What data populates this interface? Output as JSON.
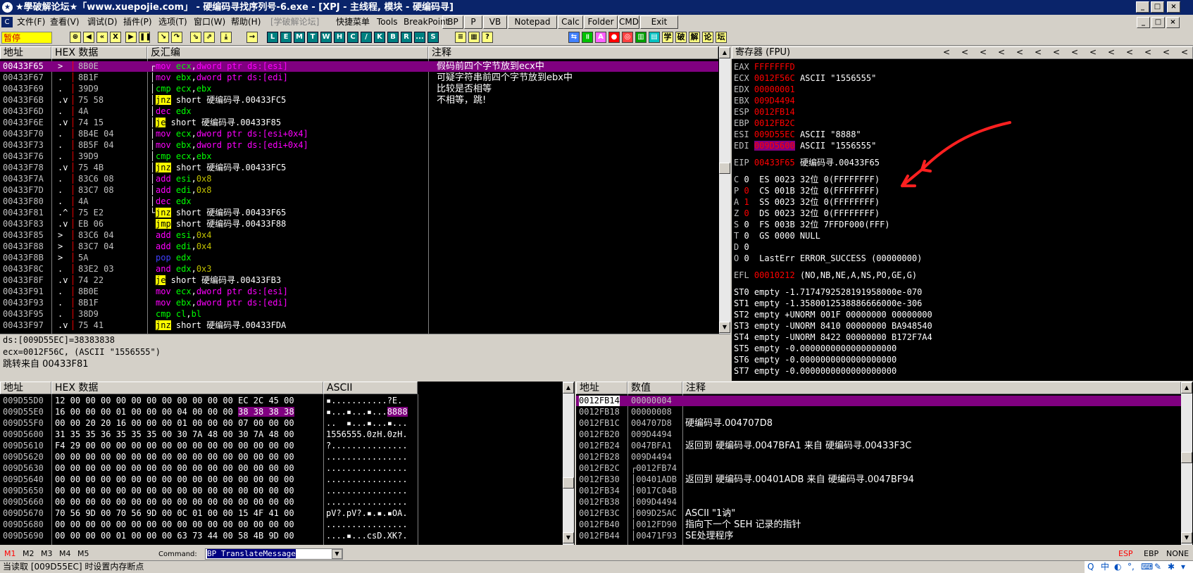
{
  "title": "★學破解论坛★「www.xuepojie.com」 - 硬编码寻找序列号-6.exe - [XPJ - 主线程, 模块 - 硬编码寻]",
  "window_buttons": [
    "_",
    "□",
    "×"
  ],
  "menu": {
    "items": [
      "文件(F)",
      "查看(V)",
      "调试(D)",
      "插件(P)",
      "选项(T)",
      "窗口(W)",
      "帮助(H)",
      "[学破解论坛]",
      "快捷菜单",
      "Tools",
      "BreakPoint"
    ],
    "buttons": [
      "BP",
      "P",
      "VB",
      "Notepad",
      "Calc",
      "Folder",
      "CMD",
      "Exit"
    ],
    "child_buttons": [
      "_",
      "□",
      "×"
    ]
  },
  "toolbar": {
    "status": "暂停",
    "letters": [
      "L",
      "E",
      "M",
      "T",
      "W",
      "H",
      "C",
      "/",
      "K",
      "B",
      "R",
      "...",
      "S"
    ],
    "cjk": [
      "学",
      "破",
      "解",
      "论",
      "坛"
    ]
  },
  "disasm": {
    "headers": {
      "addr": "地址",
      "hex": "HEX 数据",
      "asm": "反汇编",
      "comment": "注释"
    },
    "rows": [
      {
        "addr": "00433F65",
        "mark": ">",
        "hex": "8B0E",
        "asm": [
          [
            "c-mov",
            "mov "
          ],
          [
            "c-reg",
            "ecx"
          ],
          [
            "c-white",
            ","
          ],
          [
            "c-mov",
            "dword ptr ds:[esi]"
          ]
        ],
        "comment": "假码前四个字节放到ecx中",
        "sel": true,
        "bracket": "┌"
      },
      {
        "addr": "00433F67",
        "mark": ".",
        "hex": "8B1F",
        "asm": [
          [
            "c-mov",
            "mov "
          ],
          [
            "c-reg",
            "ebx"
          ],
          [
            "c-white",
            ","
          ],
          [
            "c-mov",
            "dword ptr ds:[edi]"
          ]
        ],
        "comment": "可疑字符串前四个字节放到ebx中",
        "bracket": "│"
      },
      {
        "addr": "00433F69",
        "mark": ".",
        "hex": "39D9",
        "asm": [
          [
            "c-cmp",
            "cmp "
          ],
          [
            "c-reg",
            "ecx"
          ],
          [
            "c-white",
            ","
          ],
          [
            "c-reg",
            "ebx"
          ]
        ],
        "comment": "比较是否相等",
        "bracket": "│"
      },
      {
        "addr": "00433F6B",
        "mark": ".v",
        "hex": "75 58",
        "asm": [
          [
            "kw-red",
            "jnz"
          ],
          [
            "c-white",
            " short 硬编码寻.00433FC5"
          ]
        ],
        "comment": "不相等，跳!",
        "bracket": "│"
      },
      {
        "addr": "00433F6D",
        "mark": ".",
        "hex": "4A",
        "asm": [
          [
            "c-addsub",
            "dec "
          ],
          [
            "c-reg",
            "edx"
          ]
        ],
        "comment": "",
        "bracket": "│"
      },
      {
        "addr": "00433F6E",
        "mark": ".v",
        "hex": "74 15",
        "asm": [
          [
            "kw-red",
            "je"
          ],
          [
            "c-white",
            " short 硬编码寻.00433F85"
          ]
        ],
        "comment": "",
        "bracket": "│"
      },
      {
        "addr": "00433F70",
        "mark": ".",
        "hex": "8B4E 04",
        "asm": [
          [
            "c-mov",
            "mov "
          ],
          [
            "c-reg",
            "ecx"
          ],
          [
            "c-white",
            ","
          ],
          [
            "c-mov",
            "dword ptr ds:[esi+0x4]"
          ]
        ],
        "comment": "",
        "bracket": "│"
      },
      {
        "addr": "00433F73",
        "mark": ".",
        "hex": "8B5F 04",
        "asm": [
          [
            "c-mov",
            "mov "
          ],
          [
            "c-reg",
            "ebx"
          ],
          [
            "c-white",
            ","
          ],
          [
            "c-mov",
            "dword ptr ds:[edi+0x4]"
          ]
        ],
        "comment": "",
        "bracket": "│"
      },
      {
        "addr": "00433F76",
        "mark": ".",
        "hex": "39D9",
        "asm": [
          [
            "c-cmp",
            "cmp "
          ],
          [
            "c-reg",
            "ecx"
          ],
          [
            "c-white",
            ","
          ],
          [
            "c-reg",
            "ebx"
          ]
        ],
        "comment": "",
        "bracket": "│"
      },
      {
        "addr": "00433F78",
        "mark": ".v",
        "hex": "75 4B",
        "asm": [
          [
            "kw-red",
            "jnz"
          ],
          [
            "c-white",
            " short 硬编码寻.00433FC5"
          ]
        ],
        "comment": "",
        "bracket": "│"
      },
      {
        "addr": "00433F7A",
        "mark": ".",
        "hex": "83C6 08",
        "asm": [
          [
            "c-addsub",
            "add "
          ],
          [
            "c-reg",
            "esi"
          ],
          [
            "c-white",
            ","
          ],
          [
            "c-num",
            "0x8"
          ]
        ],
        "comment": "",
        "bracket": "│"
      },
      {
        "addr": "00433F7D",
        "mark": ".",
        "hex": "83C7 08",
        "asm": [
          [
            "c-addsub",
            "add "
          ],
          [
            "c-reg",
            "edi"
          ],
          [
            "c-white",
            ","
          ],
          [
            "c-num",
            "0x8"
          ]
        ],
        "comment": "",
        "bracket": "│"
      },
      {
        "addr": "00433F80",
        "mark": ".",
        "hex": "4A",
        "asm": [
          [
            "c-addsub",
            "dec "
          ],
          [
            "c-reg",
            "edx"
          ]
        ],
        "comment": "",
        "bracket": "│"
      },
      {
        "addr": "00433F81",
        "mark": ".^",
        "hex": "75 E2",
        "asm": [
          [
            "kw-red",
            "jnz"
          ],
          [
            "c-white",
            " short 硬编码寻.00433F65"
          ]
        ],
        "comment": "",
        "bracket": "└"
      },
      {
        "addr": "00433F83",
        "mark": ".v",
        "hex": "EB 06",
        "asm": [
          [
            "kw-red",
            "jmp"
          ],
          [
            "c-white",
            " short 硬编码寻.00433F88"
          ]
        ],
        "comment": "",
        "bracket": " "
      },
      {
        "addr": "00433F85",
        "mark": ">",
        "hex": "83C6 04",
        "asm": [
          [
            "c-addsub",
            "add "
          ],
          [
            "c-reg",
            "esi"
          ],
          [
            "c-white",
            ","
          ],
          [
            "c-num",
            "0x4"
          ]
        ],
        "comment": "",
        "bracket": " "
      },
      {
        "addr": "00433F88",
        "mark": ">",
        "hex": "83C7 04",
        "asm": [
          [
            "c-addsub",
            "add "
          ],
          [
            "c-reg",
            "edi"
          ],
          [
            "c-white",
            ","
          ],
          [
            "c-num",
            "0x4"
          ]
        ],
        "comment": "",
        "bracket": " "
      },
      {
        "addr": "00433F8B",
        "mark": ">",
        "hex": "5A",
        "asm": [
          [
            "c-pop",
            "pop "
          ],
          [
            "c-reg",
            "edx"
          ]
        ],
        "comment": "",
        "bracket": " "
      },
      {
        "addr": "00433F8C",
        "mark": ".",
        "hex": "83E2 03",
        "asm": [
          [
            "c-addsub",
            "and "
          ],
          [
            "c-reg",
            "edx"
          ],
          [
            "c-white",
            ","
          ],
          [
            "c-num",
            "0x3"
          ]
        ],
        "comment": "",
        "bracket": " "
      },
      {
        "addr": "00433F8F",
        "mark": ".v",
        "hex": "74 22",
        "asm": [
          [
            "kw-red",
            "je"
          ],
          [
            "c-white",
            " short 硬编码寻.00433FB3"
          ]
        ],
        "comment": "",
        "bracket": " "
      },
      {
        "addr": "00433F91",
        "mark": ".",
        "hex": "8B0E",
        "asm": [
          [
            "c-mov",
            "mov "
          ],
          [
            "c-reg",
            "ecx"
          ],
          [
            "c-white",
            ","
          ],
          [
            "c-mov",
            "dword ptr ds:[esi]"
          ]
        ],
        "comment": "",
        "bracket": " "
      },
      {
        "addr": "00433F93",
        "mark": ".",
        "hex": "8B1F",
        "asm": [
          [
            "c-mov",
            "mov "
          ],
          [
            "c-reg",
            "ebx"
          ],
          [
            "c-white",
            ","
          ],
          [
            "c-mov",
            "dword ptr ds:[edi]"
          ]
        ],
        "comment": "",
        "bracket": " "
      },
      {
        "addr": "00433F95",
        "mark": ".",
        "hex": "38D9",
        "asm": [
          [
            "c-cmp",
            "cmp "
          ],
          [
            "c-reg",
            "cl"
          ],
          [
            "c-white",
            ","
          ],
          [
            "c-reg",
            "bl"
          ]
        ],
        "comment": "",
        "bracket": " "
      },
      {
        "addr": "00433F97",
        "mark": ".v",
        "hex": "75 41",
        "asm": [
          [
            "kw-red",
            "jnz"
          ],
          [
            "c-white",
            " short 硬编码寻.00433FDA"
          ]
        ],
        "comment": "",
        "bracket": " "
      }
    ],
    "info": [
      "ds:[009D55EC]=38383838",
      "ecx=0012F56C, (ASCII \"1556555\")",
      "跳转来自 00433F81"
    ]
  },
  "registers": {
    "header": "寄存器 (FPU)",
    "nav_arrows": [
      "<",
      "<",
      "<",
      "<",
      "<",
      "<",
      "<",
      "<",
      "<",
      "<",
      "<",
      "<",
      "<",
      "<"
    ],
    "gp": [
      {
        "name": "EAX",
        "val": "FFFFFFFD",
        "extra": ""
      },
      {
        "name": "ECX",
        "val": "0012F56C",
        "extra": " ASCII \"1556555\""
      },
      {
        "name": "EDX",
        "val": "00000001",
        "extra": ""
      },
      {
        "name": "EBX",
        "val": "009D4494",
        "extra": ""
      },
      {
        "name": "ESP",
        "val": "0012FB14",
        "extra": ""
      },
      {
        "name": "EBP",
        "val": "0012FB2C",
        "extra": ""
      },
      {
        "name": "ESI",
        "val": "009D55EC",
        "extra": " ASCII \"8888\""
      },
      {
        "name": "EDI",
        "val": "009D5600",
        "extra": " ASCII \"1556555\"",
        "hl": true
      }
    ],
    "eip": {
      "name": "EIP",
      "val": "00433F65",
      "extra": " 硬编码寻.00433F65"
    },
    "flags": [
      "C 0  ES 0023 32位 0(FFFFFFFF)",
      "P 0  CS 001B 32位 0(FFFFFFFF)",
      "A 1  SS 0023 32位 0(FFFFFFFF)",
      "Z 0  DS 0023 32位 0(FFFFFFFF)",
      "S 0  FS 003B 32位 7FFDF000(FFF)",
      "T 0  GS 0000 NULL",
      "D 0",
      "O 0  LastErr ERROR_SUCCESS (00000000)"
    ],
    "flag_values": [
      "0",
      "0",
      "1",
      "0",
      "0",
      "0",
      "0",
      "0"
    ],
    "efl": {
      "name": "EFL",
      "val": "00010212",
      "extra": " (NO,NB,NE,A,NS,PO,GE,G)"
    },
    "fpu": [
      "ST0 empty -1.7174792528191958000e-070",
      "ST1 empty -1.3580012538886666000e-306",
      "ST2 empty +UNORM 001F 00000000 00000000",
      "ST3 empty -UNORM 8410 00000000 BA948540",
      "ST4 empty -UNORM 8422 00000000 B172F7A4",
      "ST5 empty -0.0000000000000000000",
      "ST6 empty -0.0000000000000000000",
      "ST7 empty -0.0000000000000000000"
    ]
  },
  "dump": {
    "headers": {
      "addr": "地址",
      "hex": "HEX 数据",
      "ascii": "ASCII"
    },
    "rows": [
      {
        "addr": "009D55D0",
        "hex": "12 00 00 00 00 00 00 00 00 00 00 00 ",
        "hex_hl": "",
        "hex_tail": "EC 2C 45 00",
        "ascii": "▪...........?E.",
        "ascii_hl": ""
      },
      {
        "addr": "009D55E0",
        "hex": "16 00 00 00 01 00 00 00 04 00 00 00 ",
        "hex_hl": "38 38 38 38",
        "hex_tail": "",
        "ascii": "▪...▪...▪...",
        "ascii_hl": "8888"
      },
      {
        "addr": "009D55F0",
        "hex": "00 00 20 20 16 00 00 00 01 00 00 00 ",
        "hex_hl": "",
        "hex_tail": "07 00 00 00",
        "ascii": "..  ▪...▪...▪...",
        "ascii_hl": ""
      },
      {
        "addr": "009D5600",
        "hex": "31 35 35 36 35 35 35 00 30 7A 48 00 ",
        "hex_hl": "",
        "hex_tail": "30 7A 48 00",
        "ascii": "1556555.0zH.0zH.",
        "ascii_hl": ""
      },
      {
        "addr": "009D5610",
        "hex": "F4 29 00 00 00 00 00 00 00 00 00 00 ",
        "hex_hl": "",
        "hex_tail": "00 00 00 00",
        "ascii": "?...............",
        "ascii_hl": ""
      },
      {
        "addr": "009D5620",
        "hex": "00 00 00 00 00 00 00 00 00 00 00 00 ",
        "hex_hl": "",
        "hex_tail": "00 00 00 00",
        "ascii": "................",
        "ascii_hl": ""
      },
      {
        "addr": "009D5630",
        "hex": "00 00 00 00 00 00 00 00 00 00 00 00 ",
        "hex_hl": "",
        "hex_tail": "00 00 00 00",
        "ascii": "................",
        "ascii_hl": ""
      },
      {
        "addr": "009D5640",
        "hex": "00 00 00 00 00 00 00 00 00 00 00 00 ",
        "hex_hl": "",
        "hex_tail": "00 00 00 00",
        "ascii": "................",
        "ascii_hl": ""
      },
      {
        "addr": "009D5650",
        "hex": "00 00 00 00 00 00 00 00 00 00 00 00 ",
        "hex_hl": "",
        "hex_tail": "00 00 00 00",
        "ascii": "................",
        "ascii_hl": ""
      },
      {
        "addr": "009D5660",
        "hex": "00 00 00 00 00 00 00 00 00 00 00 00 ",
        "hex_hl": "",
        "hex_tail": "00 00 00 00",
        "ascii": "................",
        "ascii_hl": ""
      },
      {
        "addr": "009D5670",
        "hex": "70 56 9D 00 70 56 9D 00 0C 01 00 00 ",
        "hex_hl": "",
        "hex_tail": "15 4F 41 00",
        "ascii": "pV?.pV?.▪.▪.▪OA.",
        "ascii_hl": ""
      },
      {
        "addr": "009D5680",
        "hex": "00 00 00 00 00 00 00 00 00 00 00 00 ",
        "hex_hl": "",
        "hex_tail": "00 00 00 00",
        "ascii": "................",
        "ascii_hl": ""
      },
      {
        "addr": "009D5690",
        "hex": "00 00 00 00 01 00 00 00 63 73 44 00 ",
        "hex_hl": "",
        "hex_tail": "58 4B 9D 00",
        "ascii": "....▪...csD.XK?.",
        "ascii_hl": ""
      }
    ]
  },
  "stack": {
    "headers": {
      "addr": "地址",
      "val": "数值",
      "comment": "注释"
    },
    "rows": [
      {
        "addr": "0012FB14",
        "val": "00000004",
        "comment": "",
        "sel": true
      },
      {
        "addr": "0012FB18",
        "val": "00000008",
        "comment": ""
      },
      {
        "addr": "0012FB1C",
        "val": "004707D8",
        "comment": "硬编码寻.004707D8"
      },
      {
        "addr": "0012FB20",
        "val": "009D4494",
        "comment": ""
      },
      {
        "addr": "0012FB24",
        "val": "0047BFA1",
        "comment": "返回到 硬编码寻.0047BFA1 来自 硬编码寻.00433F3C"
      },
      {
        "addr": "0012FB28",
        "val": "009D4494",
        "comment": ""
      },
      {
        "addr": "0012FB2C",
        "val": "┌0012FB74",
        "comment": ""
      },
      {
        "addr": "0012FB30",
        "val": "│00401ADB",
        "comment": "返回到 硬编码寻.00401ADB 来自 硬编码寻.0047BF94"
      },
      {
        "addr": "0012FB34",
        "val": "│0017C04B",
        "comment": ""
      },
      {
        "addr": "0012FB38",
        "val": "│009D4494",
        "comment": ""
      },
      {
        "addr": "0012FB3C",
        "val": "│009D25AC",
        "comment": "ASCII \"1讷\""
      },
      {
        "addr": "0012FB40",
        "val": "│0012FD90",
        "comment": "指向下一个 SEH 记录的指针"
      },
      {
        "addr": "0012FB44",
        "val": "│00471F93",
        "comment": "SE处理程序"
      }
    ]
  },
  "bottom": {
    "tabs": [
      "M1",
      "M2",
      "M3",
      "M4",
      "M5"
    ],
    "command_label": "Command:",
    "command_value": "BP TranslateMessage",
    "right": [
      "ESP",
      "EBP",
      "NONE"
    ]
  },
  "status": "当读取 [009D55EC] 时设置内存断点",
  "tray_icons": [
    "Q",
    "中",
    "◐",
    "°,",
    "⌨",
    "✎",
    "✱",
    "▾"
  ]
}
